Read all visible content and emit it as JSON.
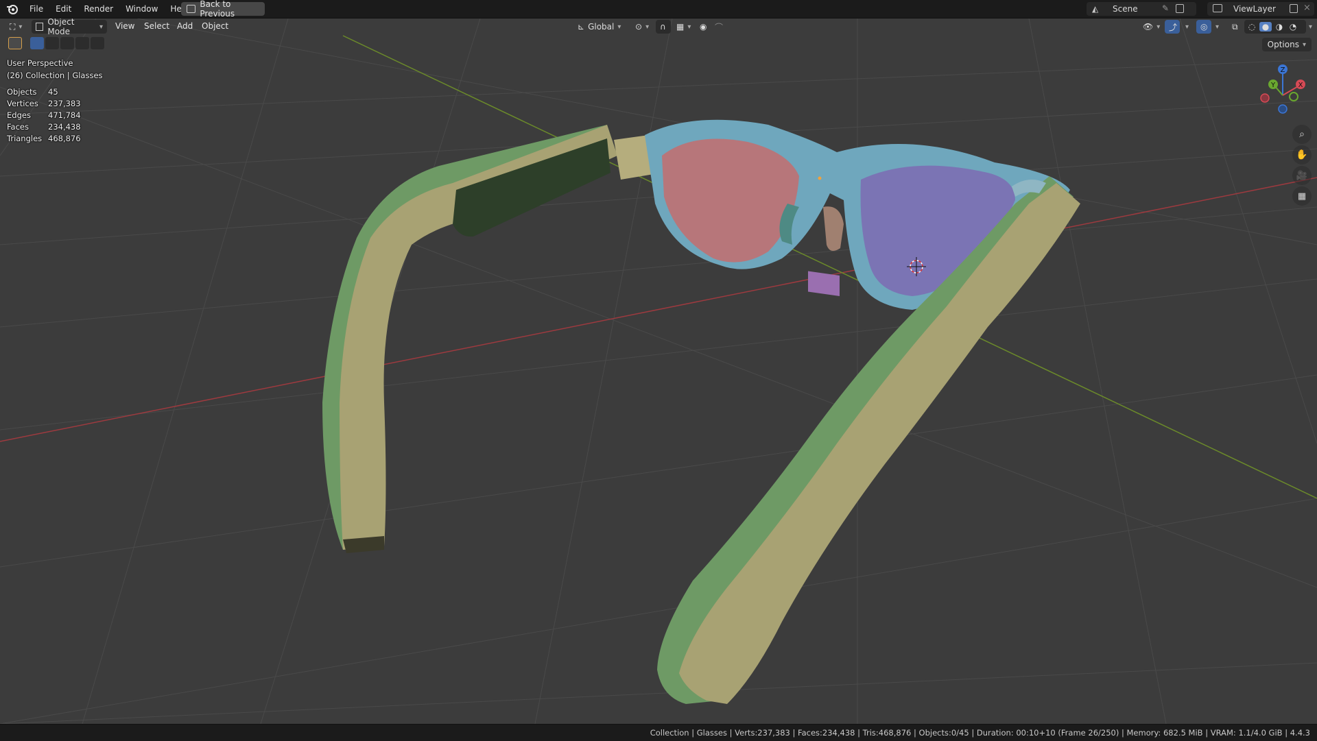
{
  "menubar": {
    "items": [
      "File",
      "Edit",
      "Render",
      "Window",
      "Help"
    ],
    "back_button": "Back to Previous",
    "scene": "Scene",
    "view_layer": "ViewLayer"
  },
  "viewport_header": {
    "mode": "Object Mode",
    "menus": [
      "View",
      "Select",
      "Add",
      "Object"
    ],
    "orientation": "Global",
    "options": "Options"
  },
  "overlay": {
    "view_name": "User Perspective",
    "collection_line": "(26) Collection | Glasses",
    "stats": [
      {
        "label": "Objects",
        "value": "45"
      },
      {
        "label": "Vertices",
        "value": "237,383"
      },
      {
        "label": "Edges",
        "value": "471,784"
      },
      {
        "label": "Faces",
        "value": "234,438"
      },
      {
        "label": "Triangles",
        "value": "468,876"
      }
    ]
  },
  "gizmo": {
    "x": "X",
    "y": "Y",
    "z": "Z"
  },
  "statusbar": {
    "text": "Collection | Glasses | Verts:237,383 | Faces:234,438 | Tris:468,876 | Objects:0/45 | Duration: 00:10+10 (Frame 26/250) | Memory: 682.5 MiB | VRAM: 1.1/4.0 GiB | 4.4.3"
  },
  "colors": {
    "axis_x": "#9e3a3f",
    "axis_y": "#6b8a2a",
    "frame_blue": "#6fa7bd",
    "temple_green": "#6e9a65",
    "temple_khaki": "#a8a273",
    "lens_red": "#b7767a",
    "lens_purple": "#7b74b4"
  }
}
